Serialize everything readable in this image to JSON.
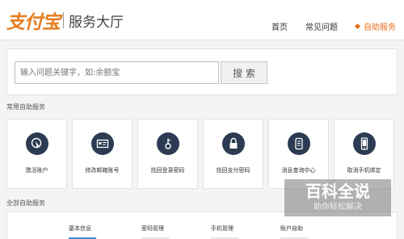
{
  "header": {
    "logo_text": "支付宝",
    "title": "服务大厅",
    "nav": [
      {
        "label": "首页"
      },
      {
        "label": "常见问题"
      },
      {
        "label": "自助服务"
      }
    ]
  },
  "search": {
    "placeholder": "输入问题关键字，如:余额宝",
    "button_label": "搜 索"
  },
  "common_section": {
    "title": "常用自助服务",
    "items": [
      {
        "label": "激活账户",
        "icon": "cursor-click-icon"
      },
      {
        "label": "修改邮箱账号",
        "icon": "id-card-icon"
      },
      {
        "label": "找回登录密码",
        "icon": "key-icon"
      },
      {
        "label": "找回支付密码",
        "icon": "lock-icon"
      },
      {
        "label": "消息查询中心",
        "icon": "document-icon"
      },
      {
        "label": "取消手机绑定",
        "icon": "phone-icon"
      }
    ]
  },
  "all_section": {
    "title": "全部自助服务",
    "categories": [
      "基本信息",
      "密码管理",
      "手机管理",
      "账户自助"
    ]
  },
  "watermark": {
    "title": "百科全说",
    "subtitle": "助你轻松解决"
  },
  "colors": {
    "accent": "#e8701a",
    "icon_bg": "#2b3b52",
    "link_blue": "#3b8fd9"
  }
}
